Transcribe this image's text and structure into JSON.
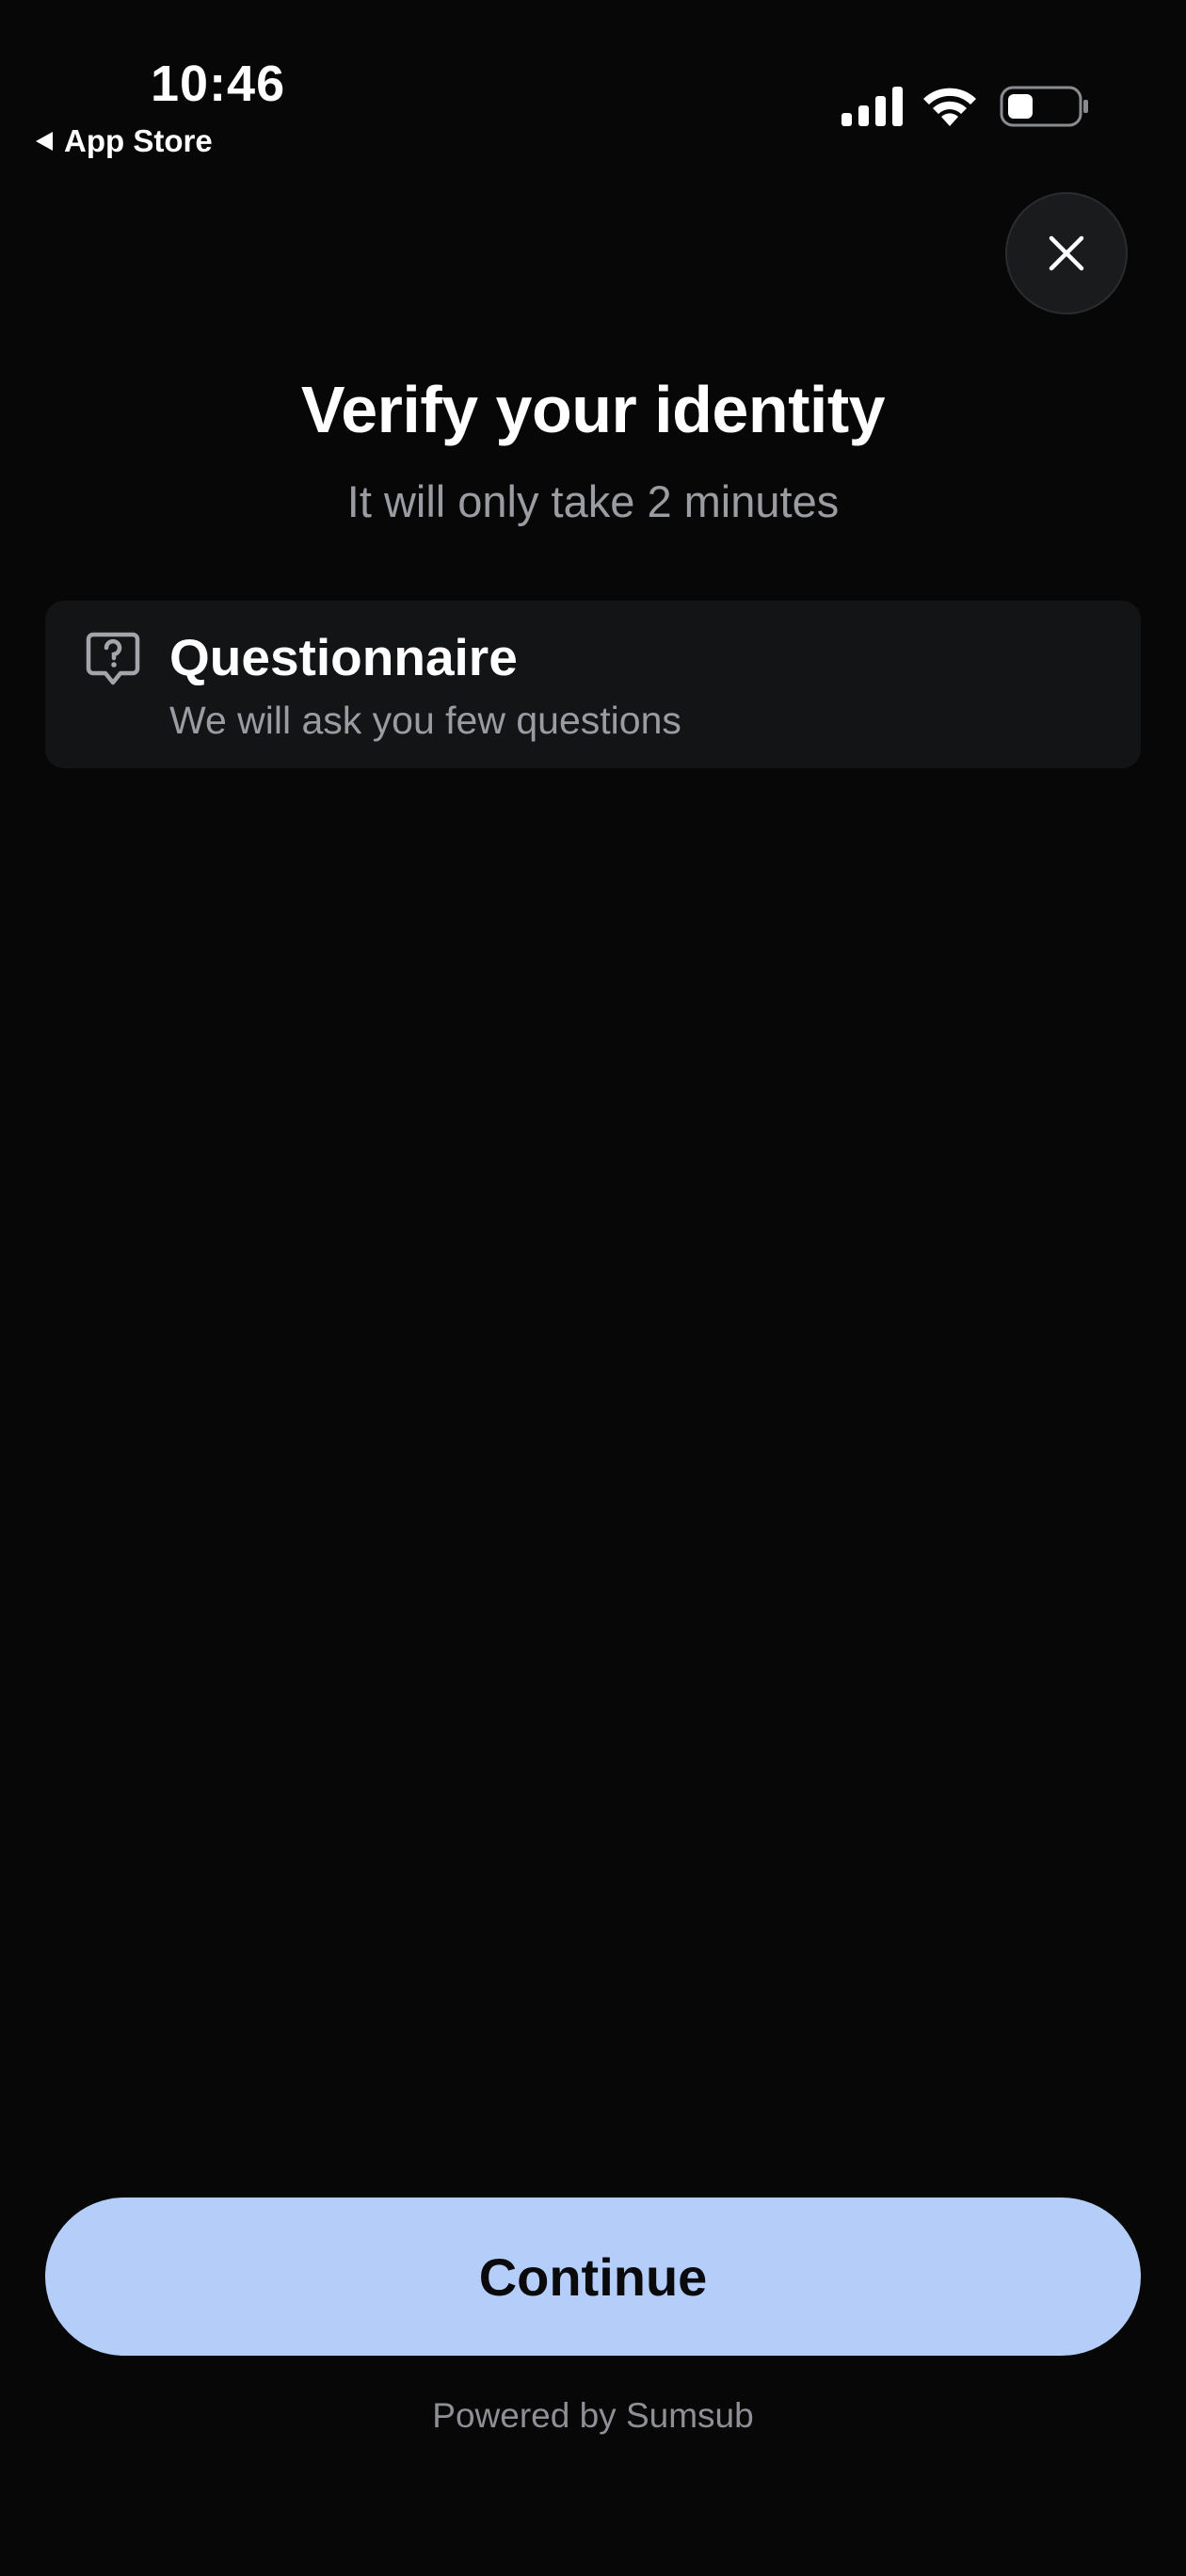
{
  "status_bar": {
    "time": "10:46",
    "back_label": "App Store",
    "icons": [
      "cellular-signal-icon",
      "wifi-icon",
      "battery-icon"
    ]
  },
  "close_button": {
    "icon": "close-icon"
  },
  "header": {
    "title": "Verify your identity",
    "subtitle": "It will only take 2 minutes"
  },
  "steps": [
    {
      "icon": "question-bubble-icon",
      "title": "Questionnaire",
      "description": "We will ask you few questions"
    }
  ],
  "footer": {
    "continue_label": "Continue",
    "powered_by": "Powered by Sumsub"
  },
  "colors": {
    "background": "#070708",
    "card": "#131416",
    "accent_button": "#b4cdf9",
    "secondary_text": "#9a9ca2"
  }
}
